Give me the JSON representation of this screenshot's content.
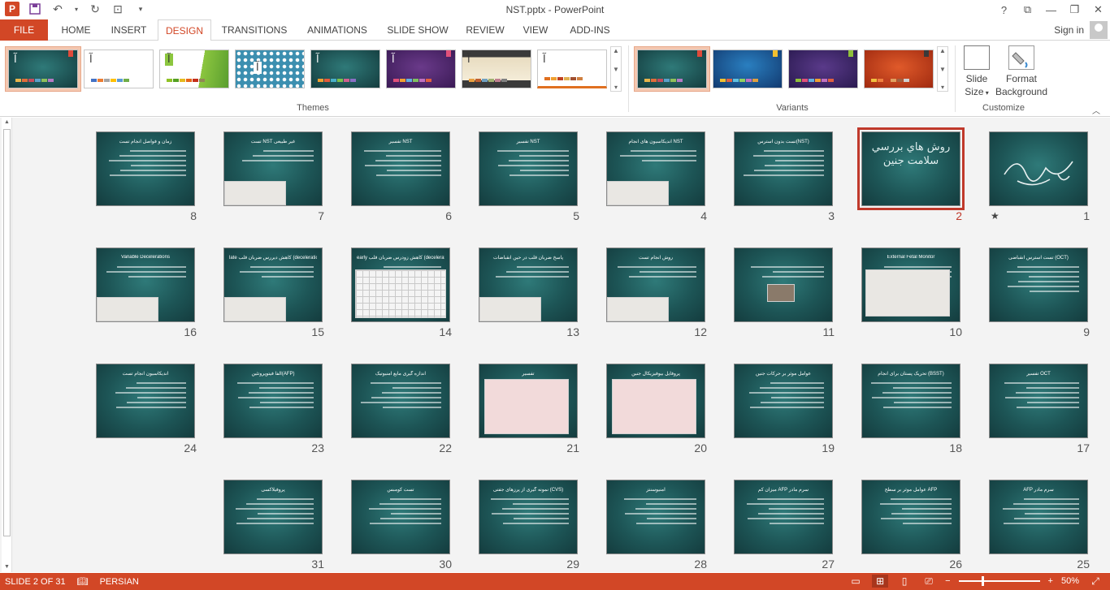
{
  "app": {
    "document_title": "NST.pptx - PowerPoint",
    "help": "?",
    "sign_in": "Sign in"
  },
  "tabs": [
    {
      "label": "FILE"
    },
    {
      "label": "HOME"
    },
    {
      "label": "INSERT"
    },
    {
      "label": "DESIGN"
    },
    {
      "label": "TRANSITIONS"
    },
    {
      "label": "ANIMATIONS"
    },
    {
      "label": "SLIDE SHOW"
    },
    {
      "label": "REVIEW"
    },
    {
      "label": "VIEW"
    },
    {
      "label": "ADD-INS"
    }
  ],
  "active_tab": "DESIGN",
  "ribbon": {
    "themes_label": "Themes",
    "variants_label": "Variants",
    "customize_label": "Customize",
    "slide_size_line1": "Slide",
    "slide_size_line2": "Size",
    "format_bg_line1": "Format",
    "format_bg_line2": "Background",
    "theme_glyph": "آ"
  },
  "slides": [
    {
      "num": "1",
      "title": "",
      "kind": "calligraphy"
    },
    {
      "num": "2",
      "title": "روش هاي بررسي سلامت جنين",
      "kind": "title",
      "selected": true
    },
    {
      "num": "3",
      "title": "تست بدون استرس(NST)",
      "kind": "text"
    },
    {
      "num": "4",
      "title": "اندیکاسیون های انجام NST",
      "kind": "text-img"
    },
    {
      "num": "5",
      "title": "تفسیر NST",
      "kind": "text"
    },
    {
      "num": "6",
      "title": "تفسیر NST",
      "kind": "text"
    },
    {
      "num": "7",
      "title": "تست NST غیر طبیعی",
      "kind": "text-img"
    },
    {
      "num": "8",
      "title": "زمان و فواصل انجام تست",
      "kind": "text"
    },
    {
      "num": "9",
      "title": "تست استرس انقباضی (OCT)",
      "kind": "text"
    },
    {
      "num": "10",
      "title": "External Fetal Monitor",
      "kind": "photo"
    },
    {
      "num": "11",
      "title": "",
      "kind": "small-photo"
    },
    {
      "num": "12",
      "title": "روش انجام تست",
      "kind": "text-img"
    },
    {
      "num": "13",
      "title": "پاسخ ضربان قلب در حین انقباضات",
      "kind": "text-img"
    },
    {
      "num": "14",
      "title": "early کاهش زودرس ضربان قلب (deceleration)",
      "kind": "grid"
    },
    {
      "num": "15",
      "title": "late کاهش دیررس ضربان قلب (deceleration)",
      "kind": "text-img"
    },
    {
      "num": "16",
      "title": "Variable Decelerations",
      "kind": "text-img"
    },
    {
      "num": "17",
      "title": "تفسیر OCT",
      "kind": "text"
    },
    {
      "num": "18",
      "title": "تحریک پستان برای انجام (BSST)",
      "kind": "text"
    },
    {
      "num": "19",
      "title": "عوامل موثر بر حرکات جنین",
      "kind": "text"
    },
    {
      "num": "20",
      "title": "پروفایل بیوفیزیکال جنین",
      "kind": "table"
    },
    {
      "num": "21",
      "title": "تفسیر",
      "kind": "table"
    },
    {
      "num": "22",
      "title": "اندازه گیری مایع آمنیوتیک",
      "kind": "text"
    },
    {
      "num": "23",
      "title": "آلفا فیتوپروتئین(AFP)",
      "kind": "text"
    },
    {
      "num": "24",
      "title": "اندیکاسیون انجام تست",
      "kind": "text"
    },
    {
      "num": "25",
      "title": "AFP سرم مادر",
      "kind": "text"
    },
    {
      "num": "26",
      "title": "عوامل موثر بر سطح AFP",
      "kind": "text"
    },
    {
      "num": "27",
      "title": "میزان کم AFP سرم مادر",
      "kind": "text"
    },
    {
      "num": "28",
      "title": "آمنیوسنتز",
      "kind": "text"
    },
    {
      "num": "29",
      "title": "نمونه گیری از پرزهای جفتی (CVS)",
      "kind": "text"
    },
    {
      "num": "30",
      "title": "تست کومبس",
      "kind": "text"
    },
    {
      "num": "31",
      "title": "پروفیلاکسی",
      "kind": "text"
    }
  ],
  "status": {
    "slide_info": "SLIDE 2 OF 31",
    "language": "PERSIAN",
    "zoom_value": "50%",
    "zoom_level_percent": 50
  },
  "colors": {
    "accent": "#d24726",
    "slide_bg": "#1d5556",
    "selection": "#c0392b"
  }
}
